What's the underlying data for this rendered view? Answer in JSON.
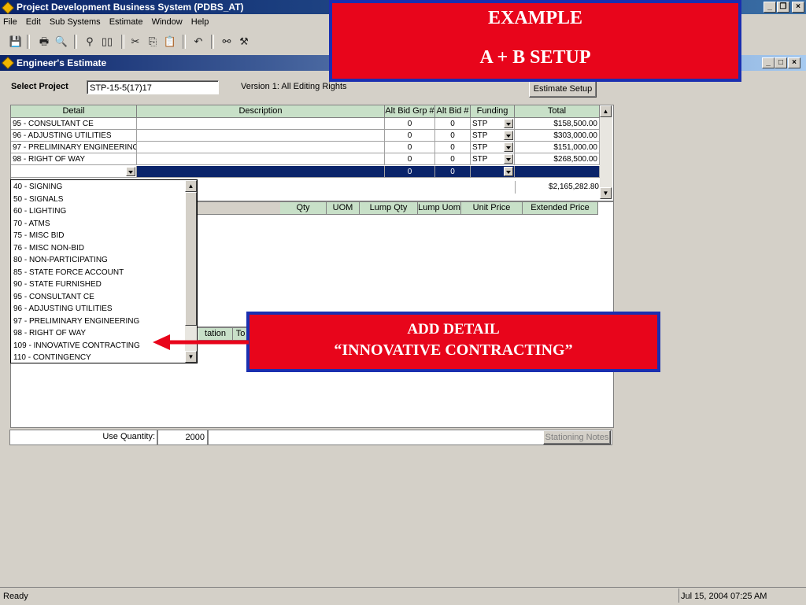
{
  "app": {
    "title": "Project Development Business System (PDBS_AT)",
    "menu": [
      "File",
      "Edit",
      "Sub Systems",
      "Estimate",
      "Window",
      "Help"
    ],
    "win_min": "_",
    "win_restore": "❐",
    "win_close": "×"
  },
  "child": {
    "title": "Engineer's Estimate",
    "select_project_label": "Select Project",
    "project_value": "STP-15-5(17)17",
    "version_text": "Version 1: All Editing Rights",
    "estimate_setup_button": "Estimate Setup"
  },
  "detail_grid": {
    "headers": [
      "Detail",
      "Description",
      "Alt Bid Grp #",
      "Alt Bid #",
      "Funding",
      "Total"
    ],
    "rows": [
      {
        "detail": "95 - CONSULTANT CE",
        "description": "",
        "alt_grp": "0",
        "alt_bid": "0",
        "funding": "STP",
        "total": "$158,500.00"
      },
      {
        "detail": "96 - ADJUSTING UTILITIES",
        "description": "",
        "alt_grp": "0",
        "alt_bid": "0",
        "funding": "STP",
        "total": "$303,000.00"
      },
      {
        "detail": "97 - PRELIMINARY ENGINEERING",
        "description": "",
        "alt_grp": "0",
        "alt_bid": "0",
        "funding": "STP",
        "total": "$151,000.00"
      },
      {
        "detail": "98 - RIGHT OF WAY",
        "description": "",
        "alt_grp": "0",
        "alt_bid": "0",
        "funding": "STP",
        "total": "$268,500.00"
      }
    ],
    "selected_row": {
      "detail": "",
      "description": "",
      "alt_grp": "0",
      "alt_bid": "0",
      "funding": "",
      "total": ""
    },
    "grand_total": "$2,165,282.80"
  },
  "items_grid": {
    "headers": [
      "Qty",
      "UOM",
      "Lump Qty",
      "Lump Uom",
      "Unit Price",
      "Extended Price"
    ]
  },
  "station_grid": {
    "headers": [
      "tation",
      "To"
    ]
  },
  "dropdown_items": [
    "40 - SIGNING",
    "50 - SIGNALS",
    "60 - LIGHTING",
    "70 - ATMS",
    "75 - MISC BID",
    "76 - MISC NON-BID",
    "80 - NON-PARTICIPATING",
    "85 - STATE FORCE ACCOUNT",
    "90 - STATE FURNISHED",
    "95 - CONSULTANT CE",
    "96 - ADJUSTING UTILITIES",
    "97 - PRELIMINARY ENGINEERING",
    "98 - RIGHT OF WAY",
    "109 - INNOVATIVE CONTRACTING",
    "110 - CONTINGENCY"
  ],
  "bottom": {
    "use_quantity_label": "Use Quantity:",
    "use_quantity_value": "2000",
    "stationing_notes_button": "Stationing Notes"
  },
  "callouts": {
    "top_line1": "EXAMPLE",
    "top_line2": "A + B SETUP",
    "mid_line1": "ADD DETAIL",
    "mid_line2": "“INNOVATIVE CONTRACTING”"
  },
  "status": {
    "left": "Ready",
    "right": "Jul 15, 2004 07:25 AM"
  },
  "colors": {
    "callout_fill": "#e8051b",
    "callout_border": "#1a2fb0",
    "arrow": "#e8051b",
    "selection": "#0a246a"
  }
}
